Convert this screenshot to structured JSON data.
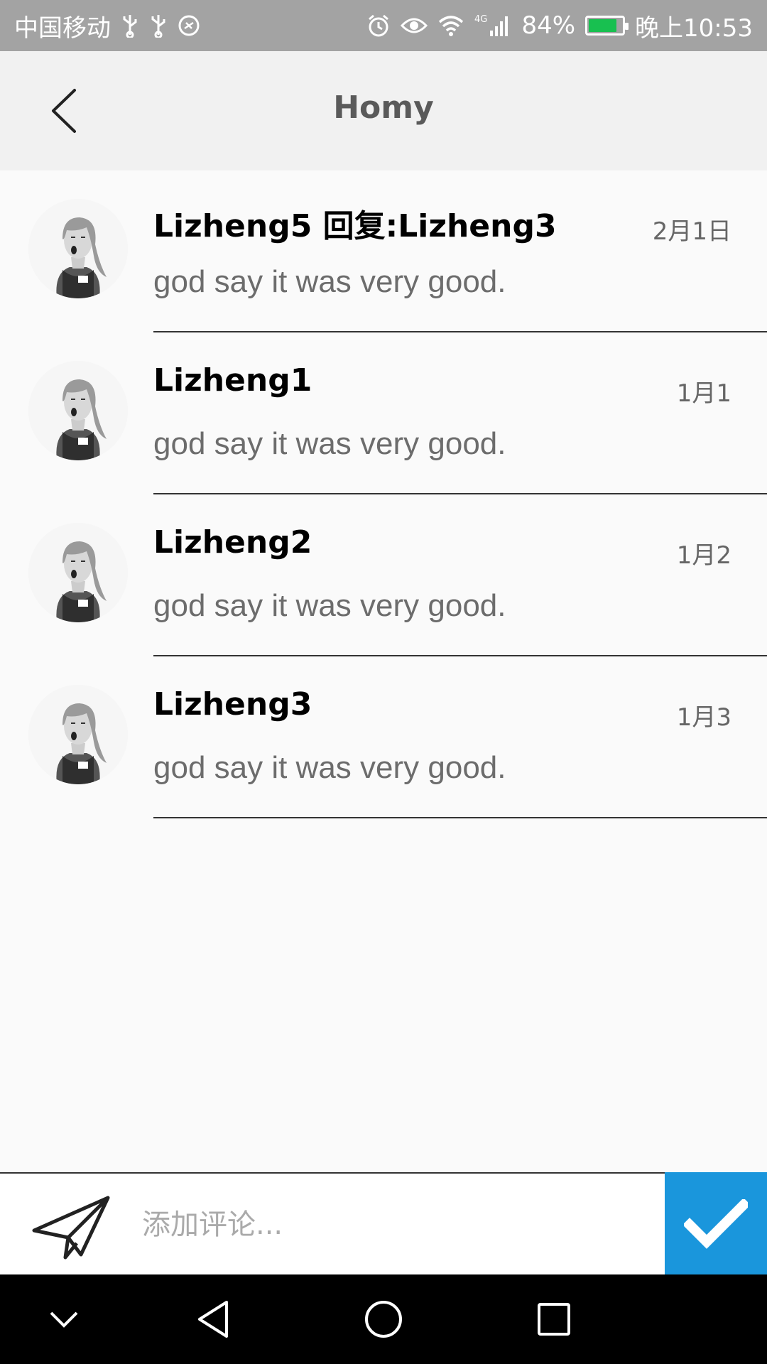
{
  "status_bar": {
    "carrier": "中国移动",
    "network": "4G",
    "battery": "84%",
    "time": "晚上10:53",
    "battery_level": 0.84,
    "battery_color": "#18c050"
  },
  "header": {
    "title": "Homy",
    "back_icon": "chevron-left-icon"
  },
  "comments": [
    {
      "name": "Lizheng5  回复:Lizheng3",
      "date": "2月1日",
      "text": "god say it was very good."
    },
    {
      "name": "Lizheng1",
      "date": "1月1",
      "text": "god say it was very good."
    },
    {
      "name": "Lizheng2",
      "date": "1月2",
      "text": "god say it was very good."
    },
    {
      "name": "Lizheng3",
      "date": "1月3",
      "text": "god say it was very good."
    }
  ],
  "comment_bar": {
    "placeholder": "添加评论...",
    "send_icon": "paper-plane-icon",
    "submit_icon": "checkmark-icon",
    "accent": "#1a96dc"
  },
  "nav_bar": {
    "icons": [
      "chevron-down-icon",
      "back-triangle-icon",
      "home-circle-icon",
      "recents-square-icon"
    ]
  }
}
